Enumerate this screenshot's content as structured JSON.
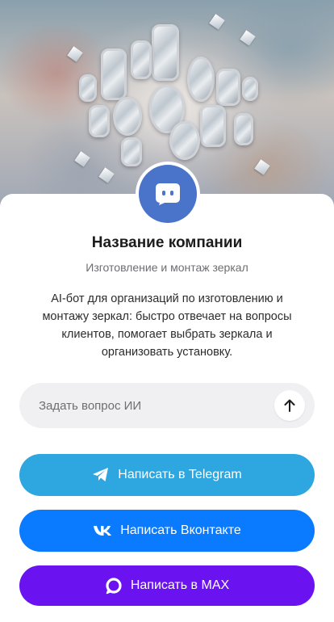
{
  "company": {
    "name": "Название компании",
    "tagline": "Изготовление и монтаж зеркал",
    "description": "AI-бот для организаций по изготовлению и монтажу зеркал: быстро отвечает на вопросы клиентов, помогает выбрать зеркала и организовать установку."
  },
  "ask": {
    "placeholder": "Задать вопрос ИИ",
    "value": ""
  },
  "buttons": {
    "telegram": "Написать в Telegram",
    "vk": "Написать Вконтакте",
    "max": "Написать в MAX"
  },
  "icons": {
    "avatar": "chat-bot-icon",
    "send": "arrow-up-icon",
    "telegram": "telegram-icon",
    "vk": "vk-icon",
    "max": "max-icon"
  },
  "colors": {
    "avatar": "#4a74c9",
    "telegram": "#2ea6df",
    "vk": "#0a7bff",
    "max": "#6a12f0",
    "input_bg": "#f0f0f2"
  }
}
